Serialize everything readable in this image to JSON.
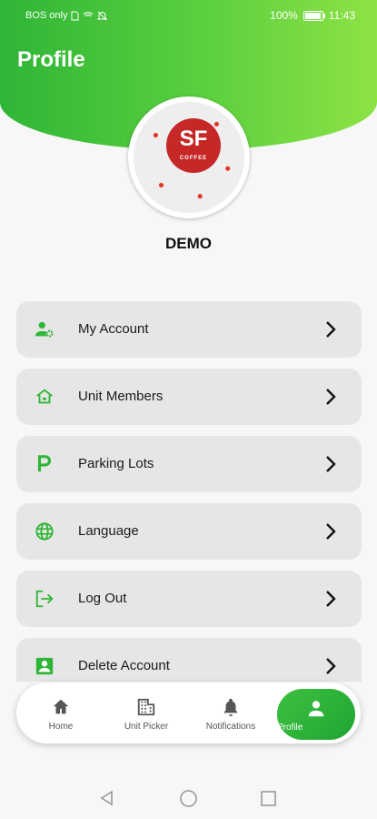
{
  "status_bar": {
    "carrier": "BOS only",
    "battery_pct": "100%",
    "time": "11:43"
  },
  "header": {
    "title": "Profile"
  },
  "profile": {
    "name": "DEMO",
    "avatar_logo": "SF",
    "avatar_logo_sub": "COFFEE"
  },
  "menu": [
    {
      "label": "My Account",
      "icon": "user-gear-icon"
    },
    {
      "label": "Unit Members",
      "icon": "home-icon"
    },
    {
      "label": "Parking Lots",
      "icon": "parking-icon"
    },
    {
      "label": "Language",
      "icon": "globe-icon"
    },
    {
      "label": "Log Out",
      "icon": "logout-icon"
    },
    {
      "label": "Delete Account",
      "icon": "account-box-icon"
    }
  ],
  "bottom_nav": [
    {
      "label": "Home",
      "icon": "home-icon"
    },
    {
      "label": "Unit Picker",
      "icon": "building-icon"
    },
    {
      "label": "Notifications",
      "icon": "bell-icon"
    },
    {
      "label": "Profile",
      "icon": "person-icon",
      "active": true
    }
  ],
  "colors": {
    "accent": "#2fb537",
    "accent_light": "#8ee245",
    "item_bg": "#e6e6e6"
  }
}
